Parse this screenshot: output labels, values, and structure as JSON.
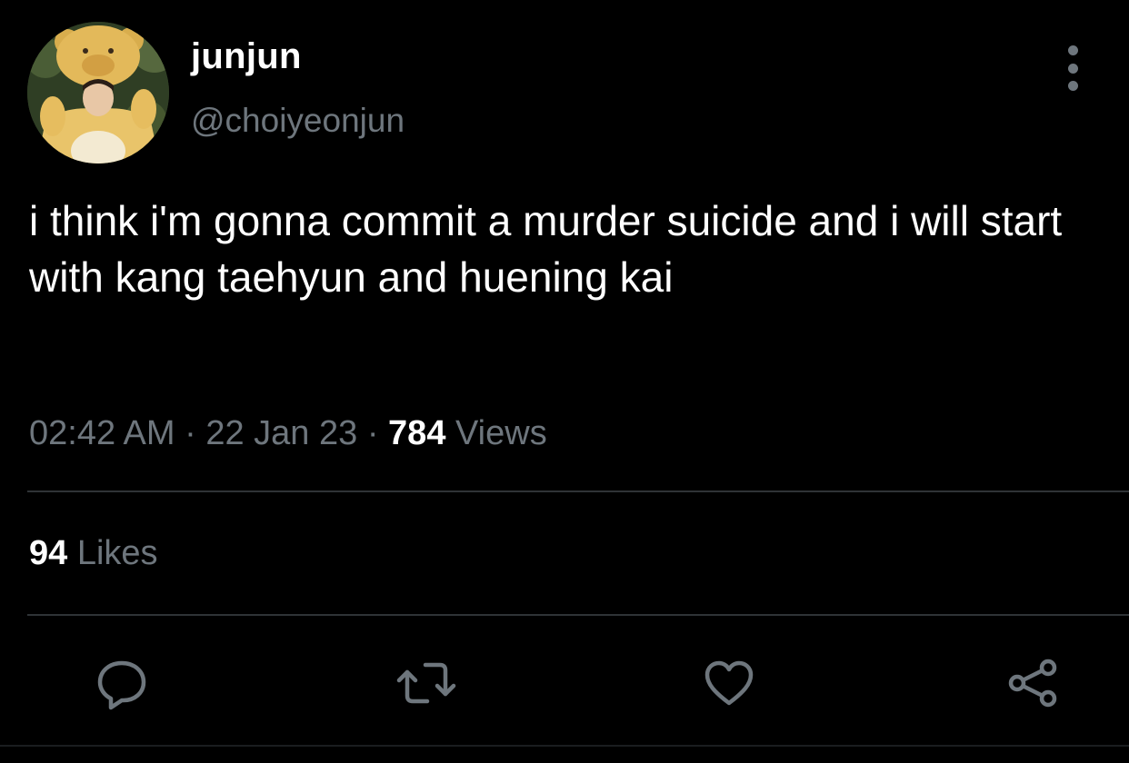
{
  "user": {
    "display_name": "junjun",
    "handle": "@choiyeonjun"
  },
  "tweet": {
    "text": "i think i'm gonna commit a murder suicide and i will start with kang taehyun and huening kai",
    "time": "02:42 AM",
    "separator": "·",
    "date": "22 Jan 23",
    "views_count": "784",
    "views_label": "Views",
    "likes_count": "94",
    "likes_label": "Likes"
  },
  "actions": [
    {
      "icon": "reply-icon"
    },
    {
      "icon": "retweet-icon"
    },
    {
      "icon": "like-icon"
    },
    {
      "icon": "share-icon"
    }
  ],
  "colors": {
    "background": "#000000",
    "text": "#ffffff",
    "secondary": "#6e767d",
    "divider": "#2f3336"
  }
}
